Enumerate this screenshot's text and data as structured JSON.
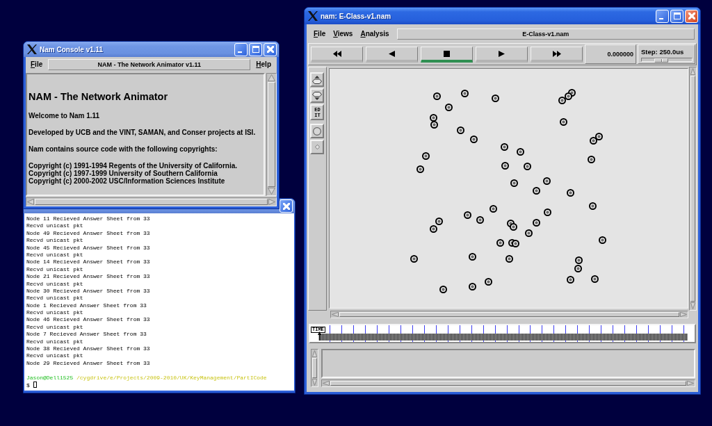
{
  "console_window": {
    "active": false,
    "title": "Nam Console v1.11",
    "menu_bar": [
      {
        "kind": "menu",
        "label": "File"
      },
      {
        "kind": "banner",
        "label": "NAM - The Network Animator v1.11"
      },
      {
        "kind": "menu",
        "label": "Help"
      }
    ],
    "text": {
      "heading": "NAM - The Network Animator",
      "paragraphs": [
        "Welcome to Nam 1.11",
        "Developed by UCB and the VINT, SAMAN, and Conser projects at ISI.",
        "Nam contains source code with the following copyrights:"
      ],
      "copyright_lines": [
        "Copyright (c) 1991-1994 Regents of the University of California.",
        "Copyright (c) 1997-1999 University of Southern California",
        "Copyright (c) 2000-2002 USC/Information Sciences Institute"
      ]
    }
  },
  "terminal_window": {
    "active": false,
    "lines": [
      "Node 11 Recieved Answer Sheet from 33",
      "Recvd unicast pkt",
      "Node 49 Recieved Answer Sheet from 33",
      "Recvd unicast pkt",
      "Node 45 Recieved Answer Sheet from 33",
      "Recvd unicast pkt",
      "Node 14 Recieved Answer Sheet from 33",
      "Recvd unicast pkt",
      "Node 21 Recieved Answer Sheet from 33",
      "Recvd unicast pkt",
      "Node 30 Recieved Answer Sheet from 33",
      "Recvd unicast pkt",
      "Node 1 Recieved Answer Sheet from 33",
      "Recvd unicast pkt",
      "Node 46 Recieved Answer Sheet from 33",
      "Recvd unicast pkt",
      "Node 7 Recieved Answer Sheet from 33",
      "Recvd unicast pkt",
      "Node 38 Recieved Answer Sheet from 33",
      "Recvd unicast pkt",
      "Node 29 Recieved Answer Sheet from 33"
    ],
    "prompt": {
      "user": "Jason@Dell1525",
      "path": "/cygdrive/e/Projects/2009-2010/UK/KeyManagement/PartICode",
      "symbol": "$"
    }
  },
  "main_window": {
    "active": true,
    "title": "nam: E-Class-v1.nam",
    "menu_bar": [
      {
        "kind": "menu",
        "label": "File"
      },
      {
        "kind": "menu",
        "label": "Views"
      },
      {
        "kind": "menu",
        "label": "Analysis"
      },
      {
        "kind": "banner",
        "label": "E-Class-v1.nam"
      }
    ],
    "playback_buttons": [
      {
        "kind": "rewind",
        "selected": false
      },
      {
        "kind": "back",
        "selected": false
      },
      {
        "kind": "stop",
        "selected": true
      },
      {
        "kind": "play",
        "selected": false
      },
      {
        "kind": "forward",
        "selected": false
      }
    ],
    "time": "0.000000",
    "step": {
      "label": "Step: 250.0us",
      "level": 0.35
    },
    "tools": [
      {
        "kind": "zoom_in"
      },
      {
        "kind": "zoom_out"
      },
      {
        "kind": "edit",
        "label": "EDIT"
      },
      {
        "kind": "circle"
      },
      {
        "kind": "diamond"
      }
    ],
    "timeline": {
      "label": "TIME",
      "level": 0
    }
  }
}
